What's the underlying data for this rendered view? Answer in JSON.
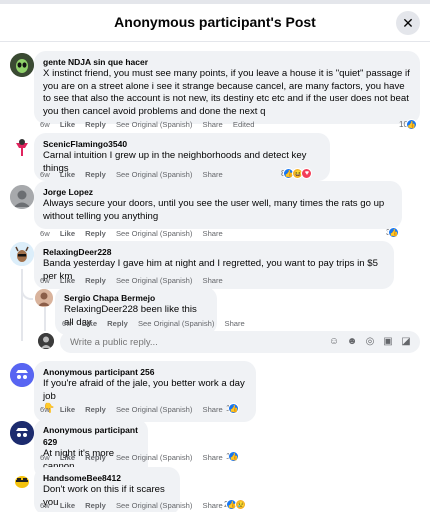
{
  "header": {
    "title": "Anonymous participant's Post"
  },
  "actions": {
    "like": "Like",
    "reply": "Reply",
    "see_original": "See Original (Spanish)",
    "share": "Share"
  },
  "comments": [
    {
      "author": "gente NDJA sin que hacer",
      "text": "X instinct friend, you must see many points, if you leave a house it is \"quiet\" passage if you are on a street alone i see it strange because cancel, are many factors, you have to see that also the account is not new, its destiny etc etc and if the user does not beat you then cancel avoid problems and done the next q",
      "time": "6w",
      "edited": "Edited",
      "reaction_count": "10"
    },
    {
      "author": "ScenicFlamingo3540",
      "text": "Carnal intuition I grew up in the neighborhoods and detect key things",
      "time": "6w",
      "reaction_count": "8"
    },
    {
      "author": "Jorge Lopez",
      "text": "Always secure your doors, until you see the user well, many times the rats go up without telling you anything",
      "time": "6w",
      "reaction_count": "3"
    },
    {
      "author": "RelaxingDeer228",
      "text": "Banda yesterday I gave him at night and I regretted, you want to pay trips in $5 per km",
      "time": "6w"
    },
    {
      "author": "Sergio Chapa Bermejo",
      "text": "RelaxingDeer228 been like this all day",
      "time": "6w"
    },
    {
      "author": "Anonymous participant 256",
      "text": "If you're afraid of the jale, you better work a day job",
      "emoji": "👇",
      "time": "6w",
      "reaction_count": "1"
    },
    {
      "author": "Anonymous participant 629",
      "text": "At night it's more cannon",
      "time": "6w",
      "reaction_count": "1"
    },
    {
      "author": "HandsomeBee8412",
      "text": "Don't work on this if it scares you",
      "time": "6w",
      "reaction_count": "2"
    }
  ],
  "reply_box": {
    "placeholder": "Write a public reply..."
  },
  "colors": {
    "link": "#1877f2",
    "bubble": "#f0f2f5",
    "muted": "#65676b"
  }
}
